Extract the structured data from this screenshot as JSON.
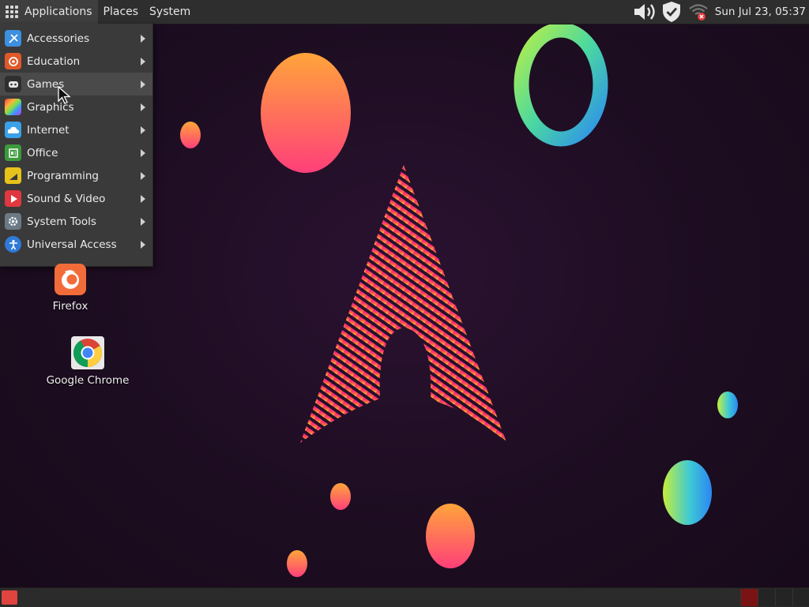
{
  "top_panel": {
    "menus": [
      "Applications",
      "Places",
      "System"
    ],
    "clock": "Sun Jul 23, 05:37",
    "tray_icons": [
      "volume-icon",
      "security-shield-icon",
      "network-disconnected-icon"
    ]
  },
  "app_menu": {
    "items": [
      {
        "label": "Accessories",
        "icon": "accessories-icon",
        "color": "#3d8fe0"
      },
      {
        "label": "Education",
        "icon": "education-icon",
        "color": "#e0592a"
      },
      {
        "label": "Games",
        "icon": "games-icon",
        "color": "#2f2f2f"
      },
      {
        "label": "Graphics",
        "icon": "graphics-icon",
        "color": "#c43de0"
      },
      {
        "label": "Internet",
        "icon": "internet-icon",
        "color": "#3aa0e8"
      },
      {
        "label": "Office",
        "icon": "office-icon",
        "color": "#3c9a3c"
      },
      {
        "label": "Programming",
        "icon": "programming-icon",
        "color": "#e6c21b"
      },
      {
        "label": "Sound & Video",
        "icon": "sound-video-icon",
        "color": "#e0383e"
      },
      {
        "label": "System Tools",
        "icon": "system-tools-icon",
        "color": "#6c7a86"
      },
      {
        "label": "Universal Access",
        "icon": "universal-access-icon",
        "color": "#2f7ad8"
      }
    ],
    "highlighted": "Games"
  },
  "desktop_icons": [
    {
      "label": "Firefox",
      "icon": "firefox-icon"
    },
    {
      "label": "Google Chrome",
      "icon": "chrome-icon"
    }
  ],
  "colors": {
    "panel_bg": "#2e2e2e",
    "desktop_bg": "#1c0e1f",
    "accent_red": "#e0443f",
    "active_workspace": "#7a1414"
  }
}
